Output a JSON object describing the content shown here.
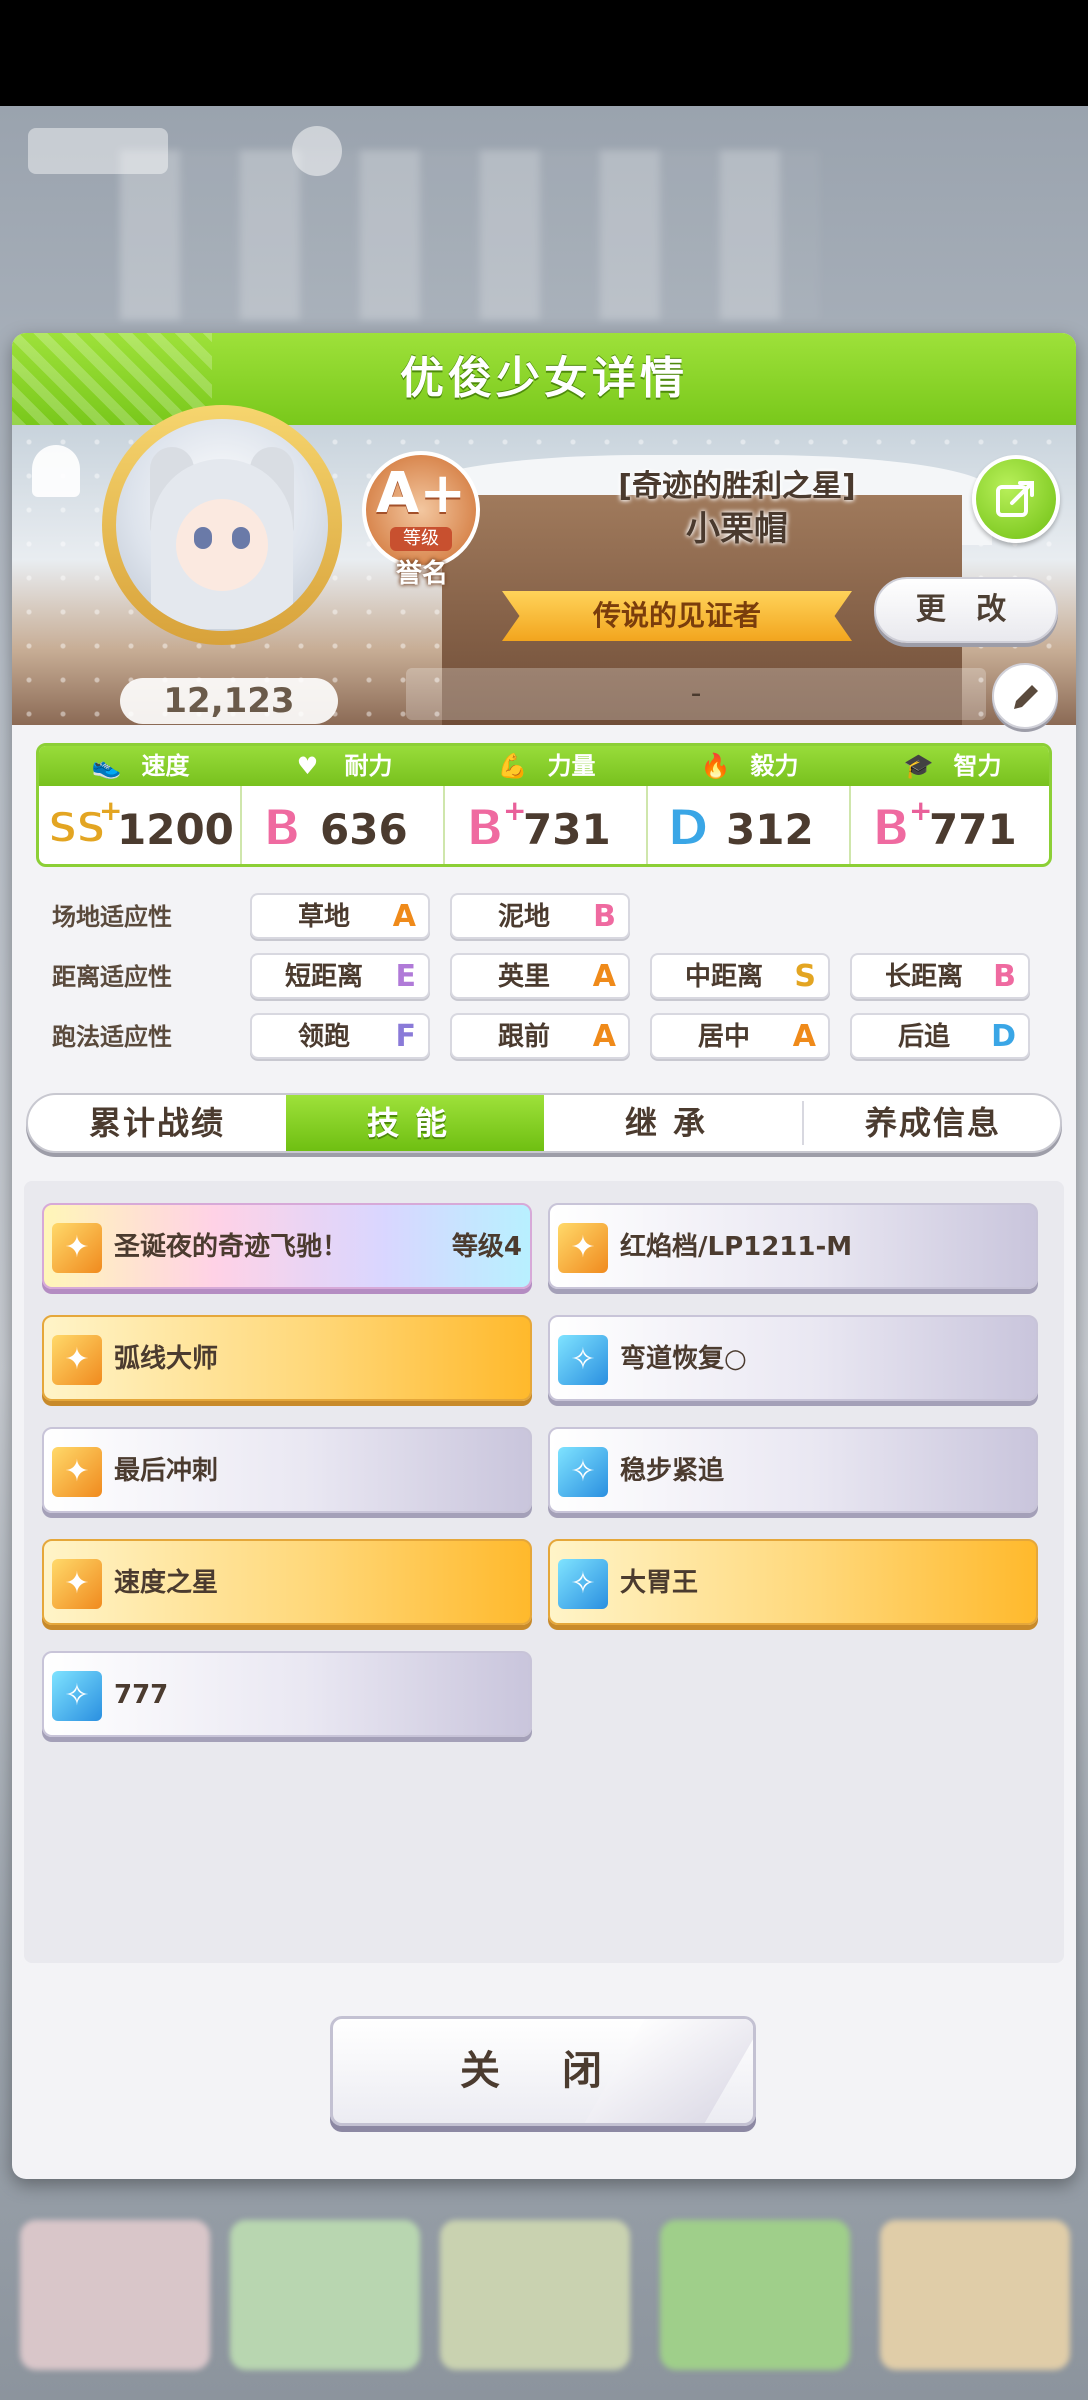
{
  "modal": {
    "title": "优俊少女详情"
  },
  "profile": {
    "score": "12,123",
    "rank_grade": "A+",
    "rank_level_label": "等级",
    "rank_title": "誉名",
    "epithet": "[奇迹的胜利之星]",
    "name": "小栗帽",
    "title_ribbon": "传说的见证者",
    "change_label": "更 改",
    "comment": "-"
  },
  "stats": [
    {
      "label": "速度",
      "grade": "SS",
      "plus": "+",
      "value": "1200",
      "icon": "shoe-icon",
      "color": "#e3a522"
    },
    {
      "label": "耐力",
      "grade": "B",
      "plus": "",
      "value": "636",
      "icon": "heart-icon",
      "color": "#ef6aa0"
    },
    {
      "label": "力量",
      "grade": "B",
      "plus": "+",
      "value": "731",
      "icon": "muscle-icon",
      "color": "#ef6aa0"
    },
    {
      "label": "毅力",
      "grade": "D",
      "plus": "",
      "value": "312",
      "icon": "fire-icon",
      "color": "#3aa6e6"
    },
    {
      "label": "智力",
      "grade": "B",
      "plus": "+",
      "value": "771",
      "icon": "graduation-cap-icon",
      "color": "#ef6aa0"
    }
  ],
  "aptitudes": {
    "track": {
      "label": "场地适应性",
      "items": [
        {
          "name": "草地",
          "grade": "A",
          "color": "#ef8a1a"
        },
        {
          "name": "泥地",
          "grade": "B",
          "color": "#ef6aa0"
        }
      ]
    },
    "distance": {
      "label": "距离适应性",
      "items": [
        {
          "name": "短距离",
          "grade": "E",
          "color": "#b07ad8"
        },
        {
          "name": "英里",
          "grade": "A",
          "color": "#ef8a1a"
        },
        {
          "name": "中距离",
          "grade": "S",
          "color": "#e3a522"
        },
        {
          "name": "长距离",
          "grade": "B",
          "color": "#ef6aa0"
        }
      ]
    },
    "style": {
      "label": "跑法适应性",
      "items": [
        {
          "name": "领跑",
          "grade": "F",
          "color": "#8a7ad8"
        },
        {
          "name": "跟前",
          "grade": "A",
          "color": "#ef8a1a"
        },
        {
          "name": "居中",
          "grade": "A",
          "color": "#ef8a1a"
        },
        {
          "name": "后追",
          "grade": "D",
          "color": "#3aa6e6"
        }
      ]
    }
  },
  "tabs": [
    {
      "label": "累计战绩",
      "active": false
    },
    {
      "label": "技能",
      "active": true
    },
    {
      "label": "继承",
      "active": false
    },
    {
      "label": "养成信息",
      "active": false
    }
  ],
  "skills": [
    {
      "name": "圣诞夜的奇迹飞驰！",
      "level": "等级4",
      "style": "rainbow",
      "icon": "speed-skill-icon"
    },
    {
      "name": "红焰档/LP1211-M",
      "level": "",
      "style": "white",
      "icon": "speed-skill-icon"
    },
    {
      "name": "弧线大师",
      "level": "",
      "style": "gold",
      "icon": "speed-skill-icon"
    },
    {
      "name": "弯道恢复○",
      "level": "",
      "style": "white",
      "icon": "recovery-skill-icon"
    },
    {
      "name": "最后冲刺",
      "level": "",
      "style": "white",
      "icon": "speed-skill-icon"
    },
    {
      "name": "稳步紧追",
      "level": "",
      "style": "white",
      "icon": "recovery-skill-icon"
    },
    {
      "name": "速度之星",
      "level": "",
      "style": "gold",
      "icon": "speed-skill-icon"
    },
    {
      "name": "大胃王",
      "level": "",
      "style": "gold",
      "icon": "recovery-skill-icon"
    },
    {
      "name": "777",
      "level": "",
      "style": "white",
      "icon": "recovery-skill-icon"
    }
  ],
  "close_label": "关 闭"
}
